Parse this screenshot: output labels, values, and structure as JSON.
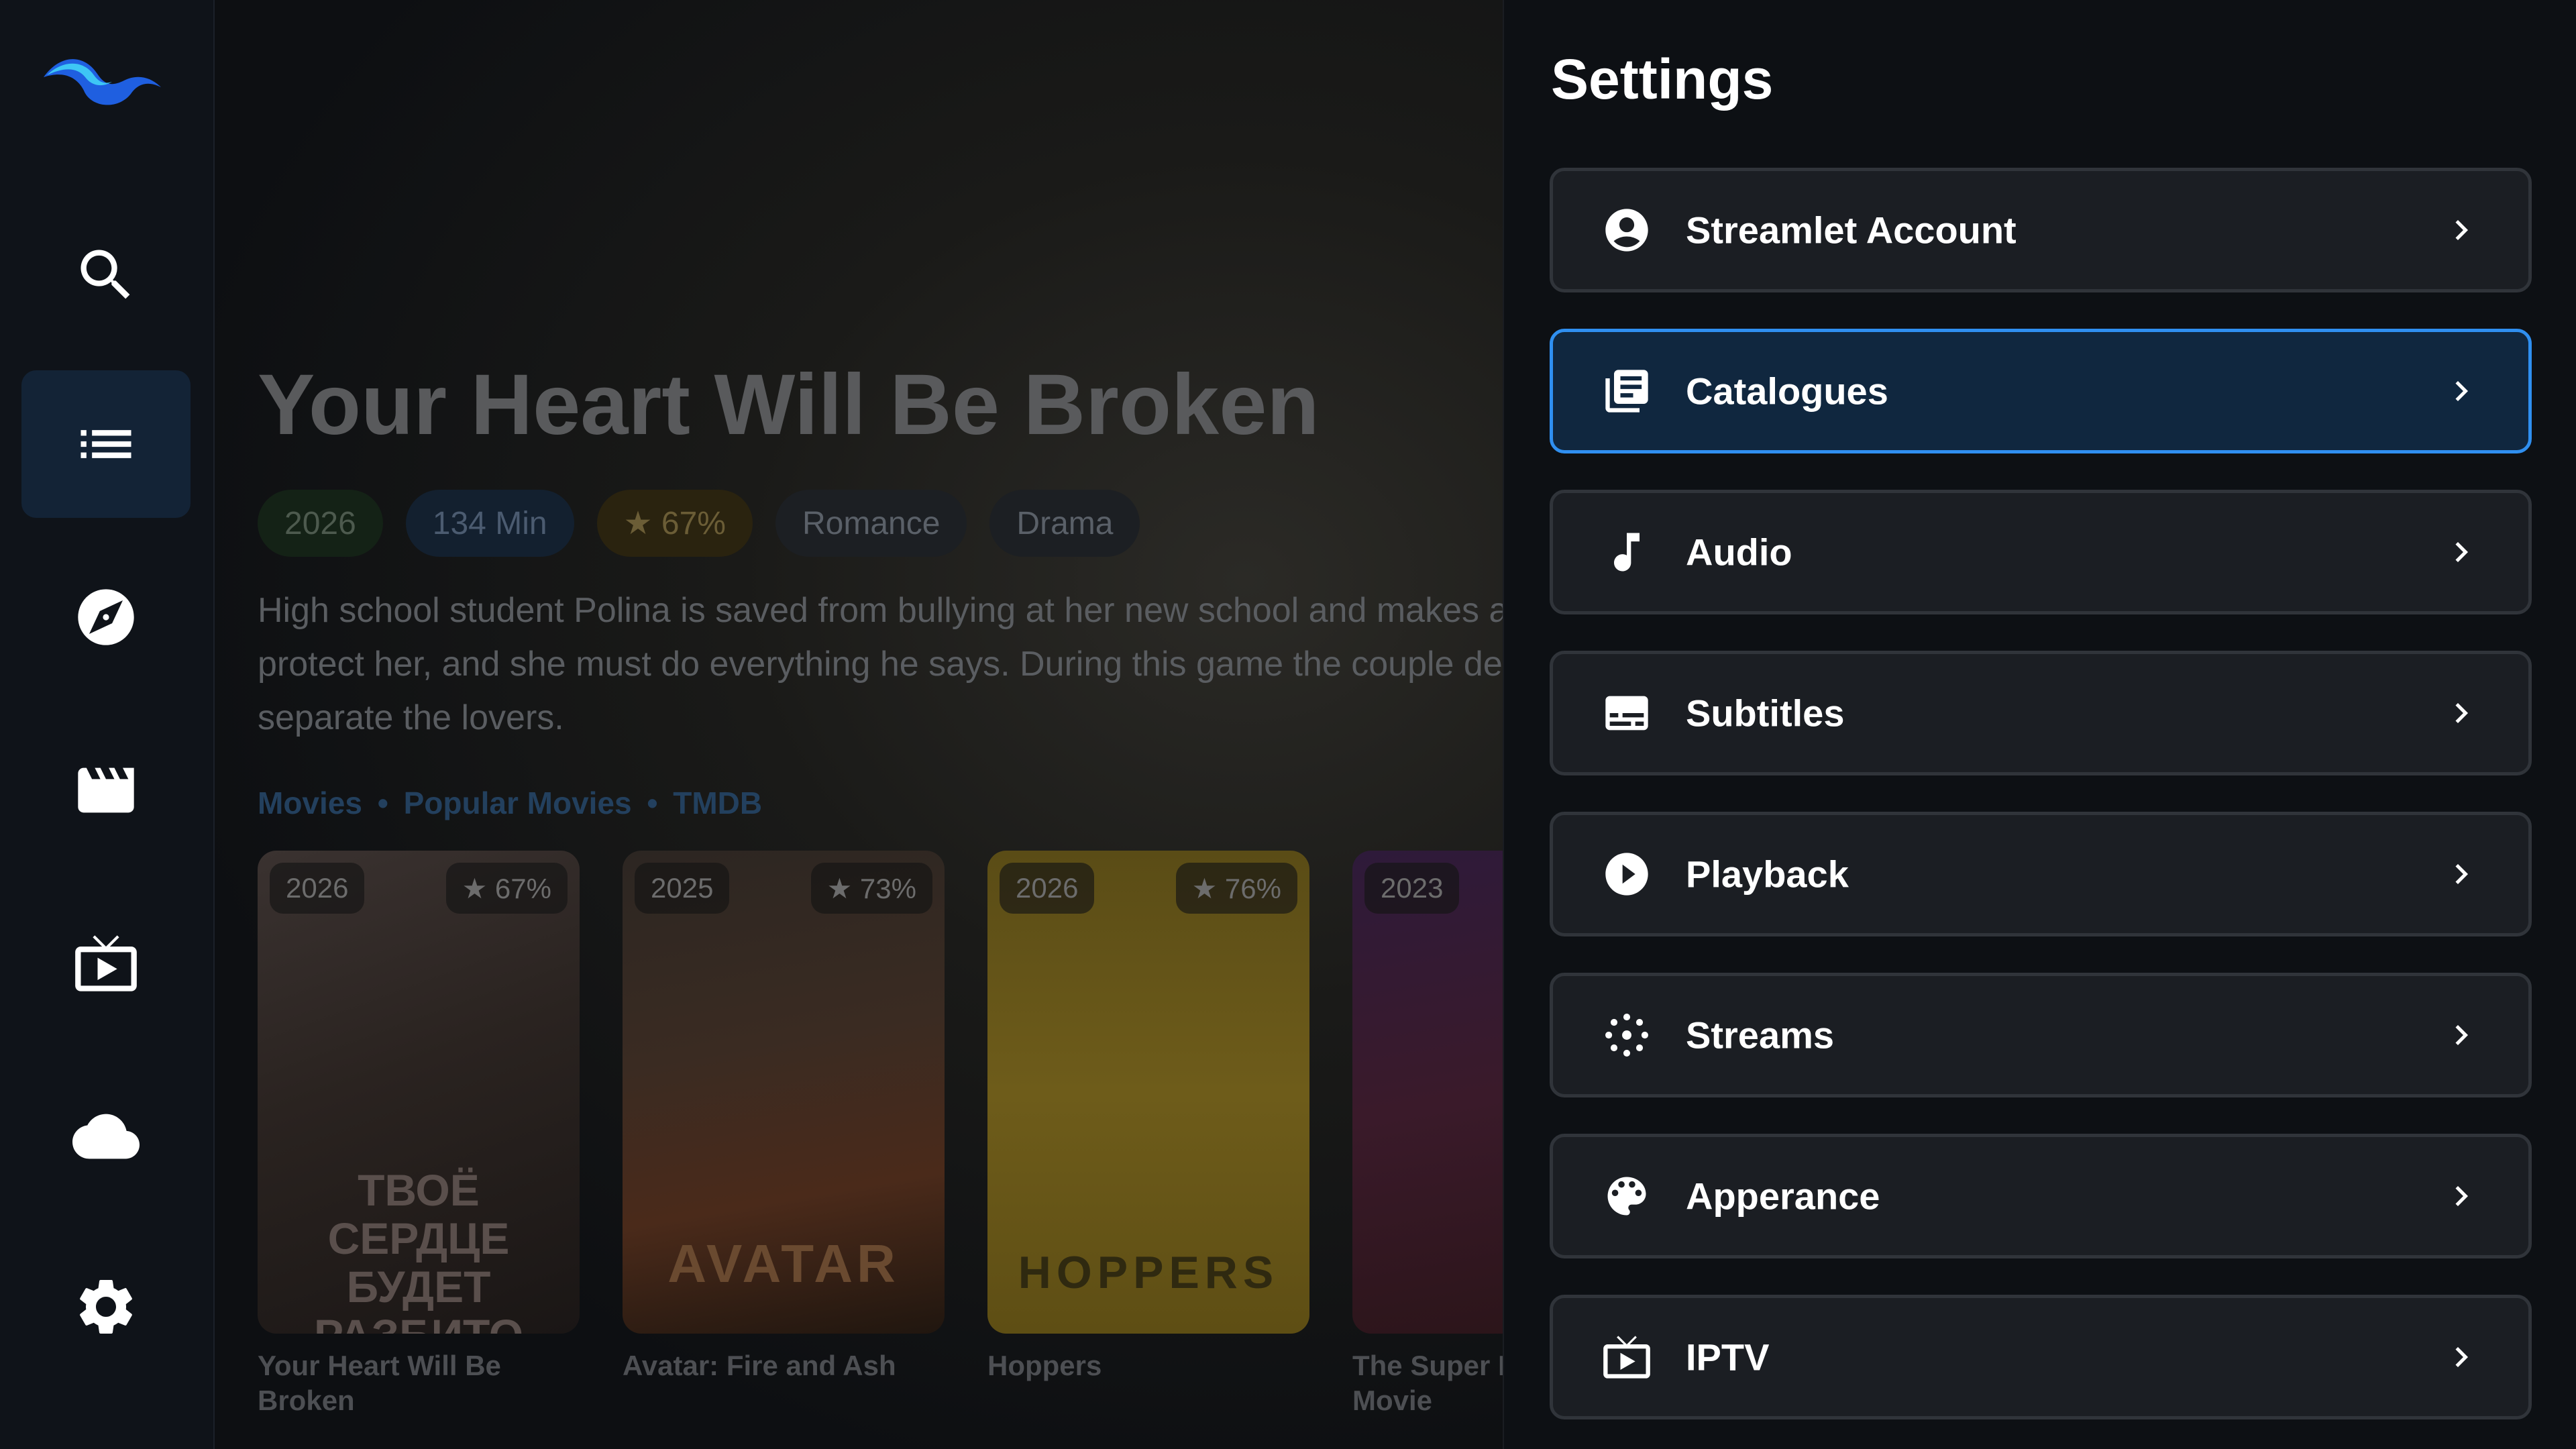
{
  "sidebar": {
    "items": [
      {
        "name": "search",
        "icon": "search-icon"
      },
      {
        "name": "catalog",
        "icon": "list-icon",
        "active": true
      },
      {
        "name": "discover",
        "icon": "compass-icon"
      },
      {
        "name": "movies",
        "icon": "clapperboard-icon"
      },
      {
        "name": "live-tv",
        "icon": "tv-icon"
      },
      {
        "name": "cloud",
        "icon": "cloud-icon"
      },
      {
        "name": "settings",
        "icon": "gear-icon"
      }
    ]
  },
  "hero": {
    "title": "Your Heart Will Be Broken",
    "chips": {
      "year": "2026",
      "duration": "134 Min",
      "rating": "★ 67%",
      "genre1": "Romance",
      "genre2": "Drama"
    },
    "description": "High school student Polina is saved from bullying at her new school and makes a deal with the main bully Bars: he must pretend to be her boyfriend and protect her, and she must do everything he says. During this game the couple develops real feelings, but her family and classmates have reasons to separate the lovers."
  },
  "breadcrumb": {
    "a": "Movies",
    "sep1": "•",
    "b": "Popular Movies",
    "sep2": "•",
    "c": "TMDB"
  },
  "posters": [
    {
      "year": "2026",
      "rating": "★ 67%",
      "title": "Your Heart Will Be Broken",
      "art_text": "ТВОЁ СЕРДЦЕ БУДЕТ РАЗБИТО"
    },
    {
      "year": "2025",
      "rating": "★ 73%",
      "title": "Avatar: Fire and Ash",
      "art_text": "AVATAR"
    },
    {
      "year": "2026",
      "rating": "★ 76%",
      "title": "Hoppers",
      "art_text": "HOPPERS"
    },
    {
      "year": "2023",
      "rating": "",
      "title": "The Super Mario Bros. Movie",
      "title_visible": "The Super Mario B Movie"
    }
  ],
  "settings": {
    "title": "Settings",
    "items": [
      {
        "label": "Streamlet Account",
        "icon": "account-circle-icon"
      },
      {
        "label": "Catalogues",
        "icon": "library-icon",
        "selected": true
      },
      {
        "label": "Audio",
        "icon": "music-note-icon"
      },
      {
        "label": "Subtitles",
        "icon": "subtitles-icon"
      },
      {
        "label": "Playback",
        "icon": "play-circle-icon"
      },
      {
        "label": "Streams",
        "icon": "streams-icon"
      },
      {
        "label": "Apperance",
        "icon": "palette-icon"
      },
      {
        "label": "IPTV",
        "icon": "tv-icon"
      }
    ]
  },
  "colors": {
    "accent": "#2f8ff0",
    "selected_bg": "#10273f",
    "row_bg": "#1b1e23"
  }
}
